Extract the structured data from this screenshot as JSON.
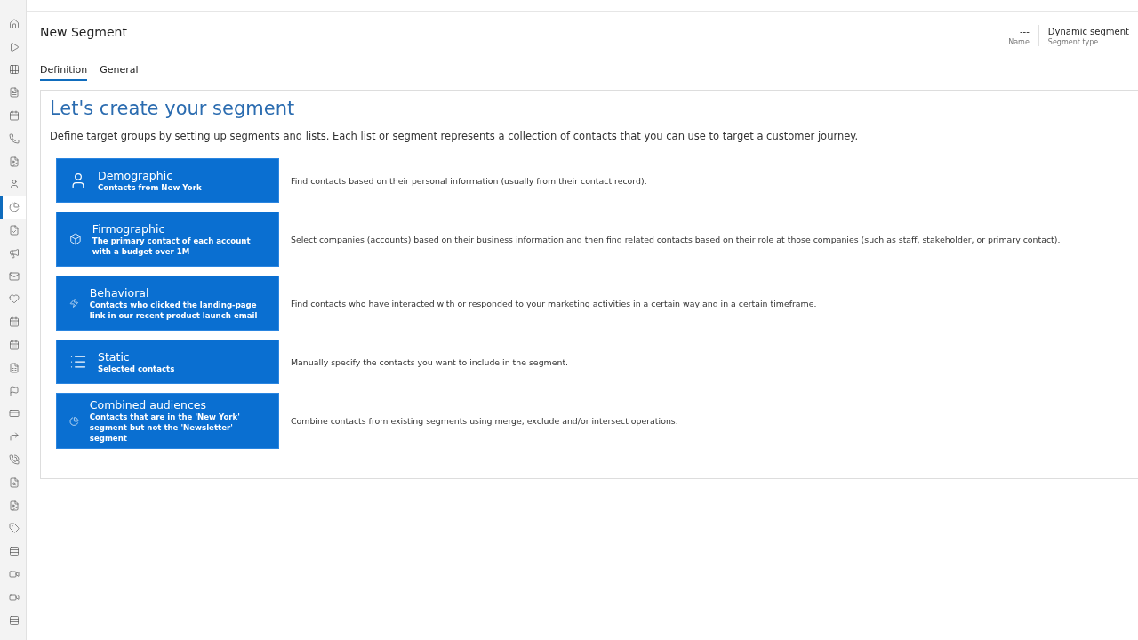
{
  "sidebar": {
    "items": [
      {
        "selected": false
      },
      {
        "selected": false
      },
      {
        "selected": false
      },
      {
        "selected": false
      },
      {
        "selected": false
      },
      {
        "selected": false
      },
      {
        "selected": false
      },
      {
        "selected": false
      },
      {
        "selected": true
      },
      {
        "selected": false
      },
      {
        "selected": false
      },
      {
        "selected": false
      },
      {
        "selected": false
      },
      {
        "selected": false
      },
      {
        "selected": false
      },
      {
        "selected": false
      },
      {
        "selected": false
      },
      {
        "selected": false
      },
      {
        "selected": false
      },
      {
        "selected": false
      },
      {
        "selected": false
      },
      {
        "selected": false
      },
      {
        "selected": false
      },
      {
        "selected": false
      },
      {
        "selected": false
      },
      {
        "selected": false
      },
      {
        "selected": false
      }
    ]
  },
  "header": {
    "title": "New Segment",
    "fields": [
      {
        "value": "---",
        "label": "Name"
      },
      {
        "value": "Dynamic segment",
        "label": "Segment type"
      }
    ]
  },
  "tabs": [
    {
      "label": "Definition",
      "selected": true
    },
    {
      "label": "General",
      "selected": false
    }
  ],
  "panel": {
    "heading": "Let's create your segment",
    "intro": "Define target groups by setting up segments and lists. Each list or segment represents a collection of contacts that you can use to target a customer journey.",
    "options": [
      {
        "kind": "demographic",
        "title": "Demographic",
        "subtitle": "Contacts from New York",
        "description": "Find contacts based on their personal information (usually from their contact record)."
      },
      {
        "kind": "firmographic",
        "title": "Firmographic",
        "subtitle": "The primary contact of each account with a budget over 1M",
        "description": "Select companies (accounts) based on their business information and then find related contacts based on their role at those companies (such as staff, stakeholder, or primary contact)."
      },
      {
        "kind": "behavioral",
        "title": "Behavioral",
        "subtitle": "Contacts who clicked the landing-page link in our recent product launch email",
        "description": "Find contacts who have interacted with or responded to your marketing activities in a certain way and in a certain timeframe."
      },
      {
        "kind": "static",
        "title": "Static",
        "subtitle": "Selected contacts",
        "description": "Manually specify the contacts you want to include in the segment."
      },
      {
        "kind": "combined",
        "title": "Combined audiences",
        "subtitle": "Contacts that are in the 'New York' segment but not the 'Newsletter' segment",
        "description": "Combine contacts from existing segments using merge, exclude and/or intersect operations."
      }
    ]
  }
}
